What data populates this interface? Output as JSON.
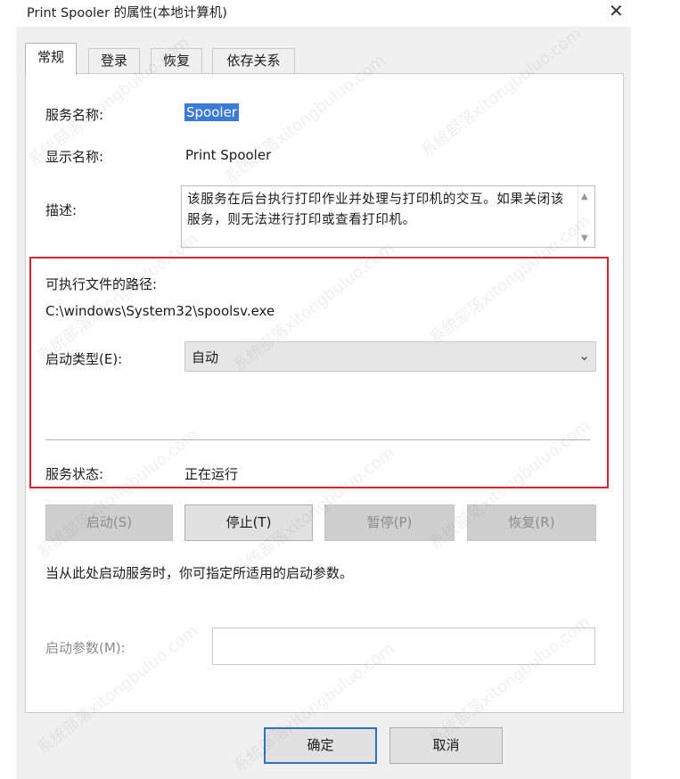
{
  "window": {
    "title": "Print Spooler 的属性(本地计算机)",
    "close_glyph": "✕"
  },
  "tabs": [
    {
      "label": "常规"
    },
    {
      "label": "登录"
    },
    {
      "label": "恢复"
    },
    {
      "label": "依存关系"
    }
  ],
  "general": {
    "service_name_label": "服务名称:",
    "service_name_value": "Spooler",
    "display_name_label": "显示名称:",
    "display_name_value": "Print Spooler",
    "description_label": "描述:",
    "description_text": "该服务在后台执行打印作业并处理与打印机的交互。如果关闭该服务，则无法进行打印或查看打印机。",
    "path_label": "可执行文件的路径:",
    "path_value": "C:\\windows\\System32\\spoolsv.exe",
    "startup_type_label": "启动类型(E):",
    "startup_type_value": "自动",
    "status_label": "服务状态:",
    "status_value": "正在运行"
  },
  "buttons": {
    "start": "启动(S)",
    "stop": "停止(T)",
    "pause": "暂停(P)",
    "resume": "恢复(R)"
  },
  "hint_text": "当从此处启动服务时，你可指定所适用的启动参数。",
  "param": {
    "label": "启动参数(M):",
    "value": ""
  },
  "footer": {
    "ok": "确定",
    "cancel": "取消"
  },
  "watermark": {
    "text": "系统部落xitongbuluo.com"
  },
  "colors": {
    "highlight": "#d9262e",
    "selection": "#3b7ad6",
    "default_button_border": "#2f6fc7"
  },
  "icons": {
    "close": "close-icon",
    "combo_arrow": "chevron-down-icon",
    "scroll_up": "scroll-up-icon",
    "scroll_down": "scroll-down-icon"
  }
}
